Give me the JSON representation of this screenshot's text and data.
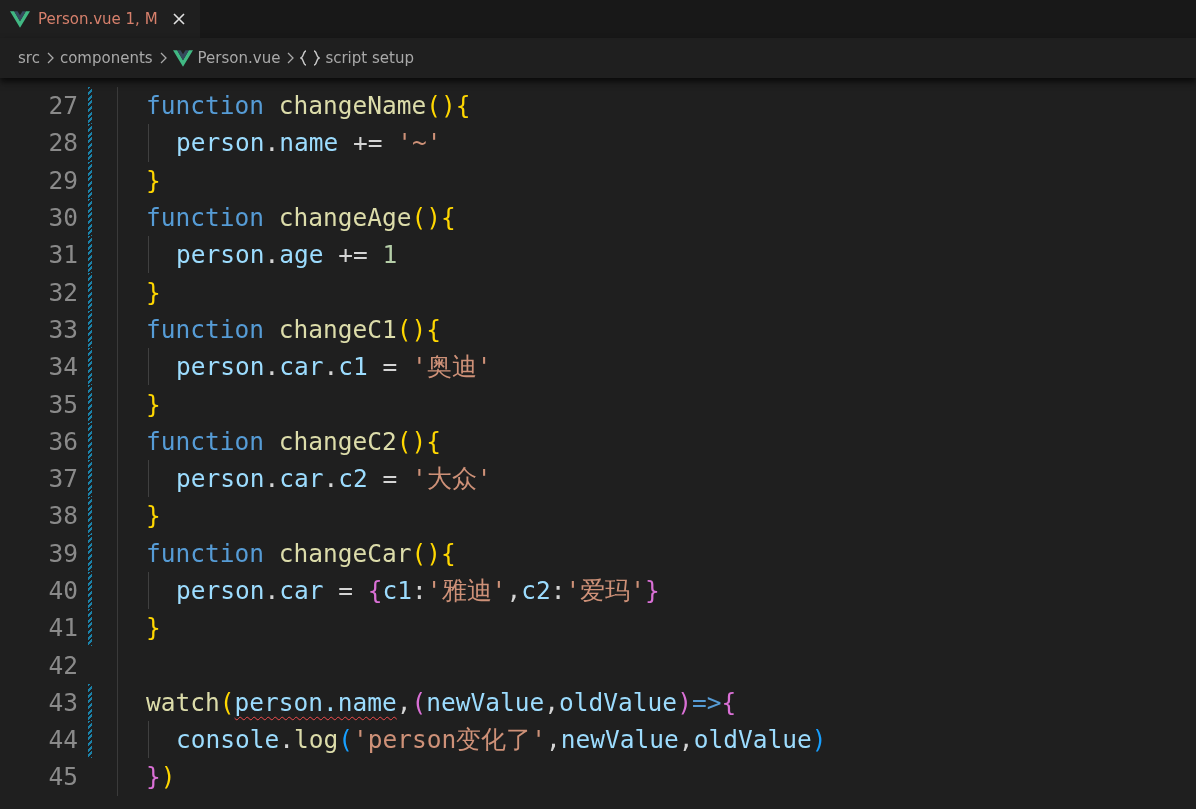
{
  "tabs": [
    {
      "label": "Person.vue",
      "status": "1, M",
      "selected": true
    }
  ],
  "breadcrumbs": [
    {
      "text": "src",
      "kind": "folder"
    },
    {
      "text": "components",
      "kind": "folder"
    },
    {
      "text": "Person.vue",
      "kind": "file"
    },
    {
      "text": "script setup",
      "kind": "symbol"
    }
  ],
  "lines": [
    {
      "number": "27",
      "modified": true,
      "indented": false,
      "tokens": [
        {
          "kind": "keyword",
          "text": "function "
        },
        {
          "kind": "function",
          "text": "changeName"
        },
        {
          "kind": "bracket1",
          "text": "()"
        },
        {
          "kind": "bracket1",
          "text": "{"
        }
      ]
    },
    {
      "number": "28",
      "modified": true,
      "indented": true,
      "tokens": [
        {
          "kind": "variable",
          "text": "person"
        },
        {
          "kind": "plain",
          "text": "."
        },
        {
          "kind": "variable",
          "text": "name"
        },
        {
          "kind": "plain",
          "text": " += "
        },
        {
          "kind": "string",
          "text": "'~'"
        }
      ]
    },
    {
      "number": "29",
      "modified": true,
      "indented": false,
      "tokens": [
        {
          "kind": "bracket1",
          "text": "}"
        }
      ]
    },
    {
      "number": "30",
      "modified": true,
      "indented": false,
      "tokens": [
        {
          "kind": "keyword",
          "text": "function "
        },
        {
          "kind": "function",
          "text": "changeAge"
        },
        {
          "kind": "bracket1",
          "text": "()"
        },
        {
          "kind": "bracket1",
          "text": "{"
        }
      ]
    },
    {
      "number": "31",
      "modified": true,
      "indented": true,
      "tokens": [
        {
          "kind": "variable",
          "text": "person"
        },
        {
          "kind": "plain",
          "text": "."
        },
        {
          "kind": "variable",
          "text": "age"
        },
        {
          "kind": "plain",
          "text": " += "
        },
        {
          "kind": "number",
          "text": "1"
        }
      ]
    },
    {
      "number": "32",
      "modified": true,
      "indented": false,
      "tokens": [
        {
          "kind": "bracket1",
          "text": "}"
        }
      ]
    },
    {
      "number": "33",
      "modified": true,
      "indented": false,
      "tokens": [
        {
          "kind": "keyword",
          "text": "function "
        },
        {
          "kind": "function",
          "text": "changeC1"
        },
        {
          "kind": "bracket1",
          "text": "()"
        },
        {
          "kind": "bracket1",
          "text": "{"
        }
      ]
    },
    {
      "number": "34",
      "modified": true,
      "indented": true,
      "tokens": [
        {
          "kind": "variable",
          "text": "person"
        },
        {
          "kind": "plain",
          "text": "."
        },
        {
          "kind": "variable",
          "text": "car"
        },
        {
          "kind": "plain",
          "text": "."
        },
        {
          "kind": "variable",
          "text": "c1"
        },
        {
          "kind": "plain",
          "text": " = "
        },
        {
          "kind": "string",
          "text": "'奥迪'"
        }
      ]
    },
    {
      "number": "35",
      "modified": true,
      "indented": false,
      "tokens": [
        {
          "kind": "bracket1",
          "text": "}"
        }
      ]
    },
    {
      "number": "36",
      "modified": true,
      "indented": false,
      "tokens": [
        {
          "kind": "keyword",
          "text": "function "
        },
        {
          "kind": "function",
          "text": "changeC2"
        },
        {
          "kind": "bracket1",
          "text": "()"
        },
        {
          "kind": "bracket1",
          "text": "{"
        }
      ]
    },
    {
      "number": "37",
      "modified": true,
      "indented": true,
      "tokens": [
        {
          "kind": "variable",
          "text": "person"
        },
        {
          "kind": "plain",
          "text": "."
        },
        {
          "kind": "variable",
          "text": "car"
        },
        {
          "kind": "plain",
          "text": "."
        },
        {
          "kind": "variable",
          "text": "c2"
        },
        {
          "kind": "plain",
          "text": " = "
        },
        {
          "kind": "string",
          "text": "'大众'"
        }
      ]
    },
    {
      "number": "38",
      "modified": true,
      "indented": false,
      "tokens": [
        {
          "kind": "bracket1",
          "text": "}"
        }
      ]
    },
    {
      "number": "39",
      "modified": true,
      "indented": false,
      "tokens": [
        {
          "kind": "keyword",
          "text": "function "
        },
        {
          "kind": "function",
          "text": "changeCar"
        },
        {
          "kind": "bracket1",
          "text": "()"
        },
        {
          "kind": "bracket1",
          "text": "{"
        }
      ]
    },
    {
      "number": "40",
      "modified": true,
      "indented": true,
      "tokens": [
        {
          "kind": "variable",
          "text": "person"
        },
        {
          "kind": "plain",
          "text": "."
        },
        {
          "kind": "variable",
          "text": "car"
        },
        {
          "kind": "plain",
          "text": " = "
        },
        {
          "kind": "bracket2",
          "text": "{"
        },
        {
          "kind": "variable",
          "text": "c1"
        },
        {
          "kind": "plain",
          "text": ":"
        },
        {
          "kind": "string",
          "text": "'雅迪'"
        },
        {
          "kind": "plain",
          "text": ","
        },
        {
          "kind": "variable",
          "text": "c2"
        },
        {
          "kind": "plain",
          "text": ":"
        },
        {
          "kind": "string",
          "text": "'爱玛'"
        },
        {
          "kind": "bracket2",
          "text": "}"
        }
      ]
    },
    {
      "number": "41",
      "modified": true,
      "indented": false,
      "tokens": [
        {
          "kind": "bracket1",
          "text": "}"
        }
      ]
    },
    {
      "number": "42",
      "modified": false,
      "indented": false
    },
    {
      "number": "43",
      "modified": true,
      "indented": false,
      "tokens": [
        {
          "kind": "function",
          "text": "watch"
        },
        {
          "kind": "bracket1",
          "text": "("
        },
        {
          "kind": "variable",
          "text": "person.name",
          "error": true
        },
        {
          "kind": "plain",
          "text": ","
        },
        {
          "kind": "bracket2",
          "text": "("
        },
        {
          "kind": "variable",
          "text": "newValue"
        },
        {
          "kind": "plain",
          "text": ","
        },
        {
          "kind": "variable",
          "text": "oldValue"
        },
        {
          "kind": "bracket2",
          "text": ")"
        },
        {
          "kind": "keyword",
          "text": "=>"
        },
        {
          "kind": "bracket2",
          "text": "{"
        }
      ]
    },
    {
      "number": "44",
      "modified": true,
      "indented": true,
      "tokens": [
        {
          "kind": "variable",
          "text": "console"
        },
        {
          "kind": "plain",
          "text": "."
        },
        {
          "kind": "function",
          "text": "log"
        },
        {
          "kind": "bracket3",
          "text": "("
        },
        {
          "kind": "string",
          "text": "'person变化了'"
        },
        {
          "kind": "plain",
          "text": ","
        },
        {
          "kind": "variable",
          "text": "newValue"
        },
        {
          "kind": "plain",
          "text": ","
        },
        {
          "kind": "variable",
          "text": "oldValue"
        },
        {
          "kind": "bracket3",
          "text": ")"
        }
      ]
    },
    {
      "number": "45",
      "modified": false,
      "indented": false,
      "tokens": [
        {
          "kind": "bracket2",
          "text": "}"
        },
        {
          "kind": "bracket1",
          "text": ")"
        }
      ]
    }
  ]
}
